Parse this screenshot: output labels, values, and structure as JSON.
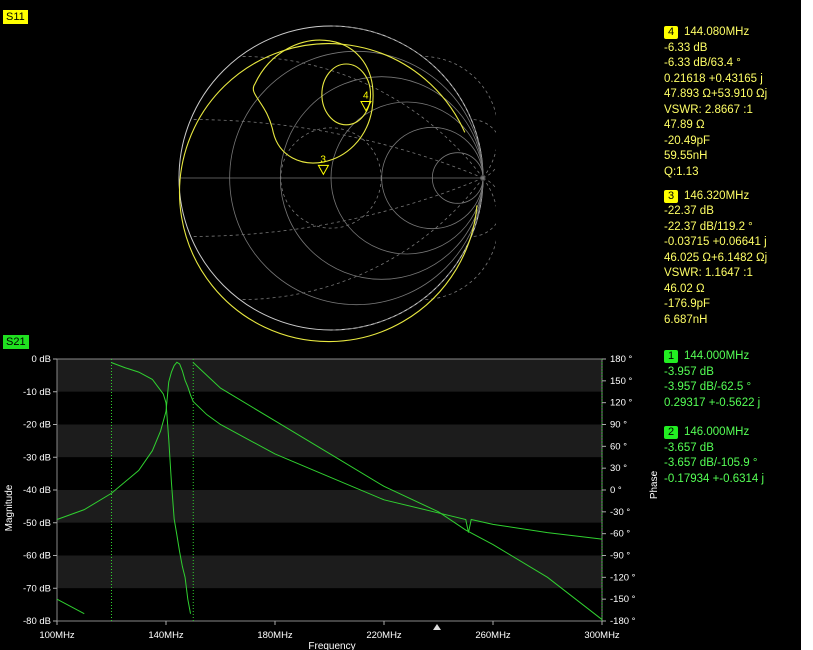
{
  "s11": {
    "badge": "S11",
    "marker_labels": [
      "4",
      "3"
    ],
    "markers": [
      {
        "num": "4",
        "freq": "144.080MHz",
        "lines": [
          "-6.33 dB",
          "-6.33 dB/63.4 °",
          "0.21618 +0.43165 j",
          "47.893 Ω+53.910 Ωj",
          "VSWR: 2.8667 :1",
          "47.89 Ω",
          "-20.49pF",
          "59.55nH",
          "Q:1.13"
        ]
      },
      {
        "num": "3",
        "freq": "146.320MHz",
        "lines": [
          "-22.37 dB",
          "-22.37 dB/119.2 °",
          "-0.03715 +0.06641 j",
          "46.025 Ω+6.1482 Ωj",
          "VSWR: 1.1647 :1",
          "46.02 Ω",
          "-176.9pF",
          "6.687nH"
        ]
      }
    ]
  },
  "s21": {
    "badge": "S21",
    "markers": [
      {
        "num": "1",
        "freq": "144.000MHz",
        "lines": [
          "-3.957 dB",
          "-3.957 dB/-62.5 °",
          "0.29317 +-0.5622 j"
        ]
      },
      {
        "num": "2",
        "freq": "146.000MHz",
        "lines": [
          "-3.657 dB",
          "-3.657 dB/-105.9 °",
          "-0.17934 +-0.6314 j"
        ]
      }
    ]
  },
  "colors": {
    "s11_trace": "#e8e840",
    "s21_trace": "#30d030",
    "grid": "#666666",
    "band_dark": "#1c1c1c"
  },
  "chart_data": {
    "type": "line",
    "xlabel": "Frequency",
    "ylabel": "Magnitude",
    "y2label": "Phase",
    "xlim": [
      100,
      300
    ],
    "ylim": [
      -80,
      0
    ],
    "y2lim": [
      -180,
      180
    ],
    "x_ticks": [
      "100MHz",
      "140MHz",
      "180MHz",
      "220MHz",
      "260MHz",
      "300MHz"
    ],
    "y_ticks": [
      "0 dB",
      "-10 dB",
      "-20 dB",
      "-30 dB",
      "-40 dB",
      "-50 dB",
      "-60 dB",
      "-70 dB",
      "-80 dB"
    ],
    "y2_ticks": [
      "180 °",
      "150 °",
      "120 °",
      "90 °",
      "60 °",
      "30 °",
      "0 °",
      "-30 °",
      "-60 °",
      "-90 °",
      "-120 °",
      "-150 °",
      "-180 °"
    ],
    "series": [
      {
        "axis": "magnitude",
        "x": [
          100,
          110,
          120,
          130,
          135,
          138,
          140,
          141,
          142,
          143,
          144,
          145,
          146,
          147,
          148,
          149,
          150,
          155,
          160,
          180,
          200,
          220,
          240,
          250,
          251,
          252,
          260,
          280,
          300
        ],
        "values": [
          -49,
          -46,
          -41,
          -34,
          -28,
          -22,
          -16,
          -7,
          -4,
          -2,
          -1,
          -1.5,
          -3.6,
          -6.5,
          -8.5,
          -11,
          -13,
          -17,
          -20,
          -29,
          -36,
          -43,
          -47,
          -49,
          -53,
          -49,
          -50.5,
          -53,
          -55
        ]
      },
      {
        "axis": "phase",
        "x": [
          100,
          110,
          120,
          125,
          130,
          135,
          137,
          139,
          140,
          141,
          142,
          143,
          144,
          145,
          146,
          147,
          148,
          149,
          150,
          160,
          180,
          200,
          220,
          240,
          250,
          260,
          280,
          300
        ],
        "values": [
          -150,
          -170,
          175,
          168,
          162,
          152,
          142,
          132,
          120,
          70,
          10,
          -40,
          -62,
          -85,
          -105,
          -120,
          -150,
          -170,
          175,
          140,
          95,
          50,
          5,
          -30,
          -55,
          -75,
          -120,
          -178
        ]
      }
    ]
  }
}
